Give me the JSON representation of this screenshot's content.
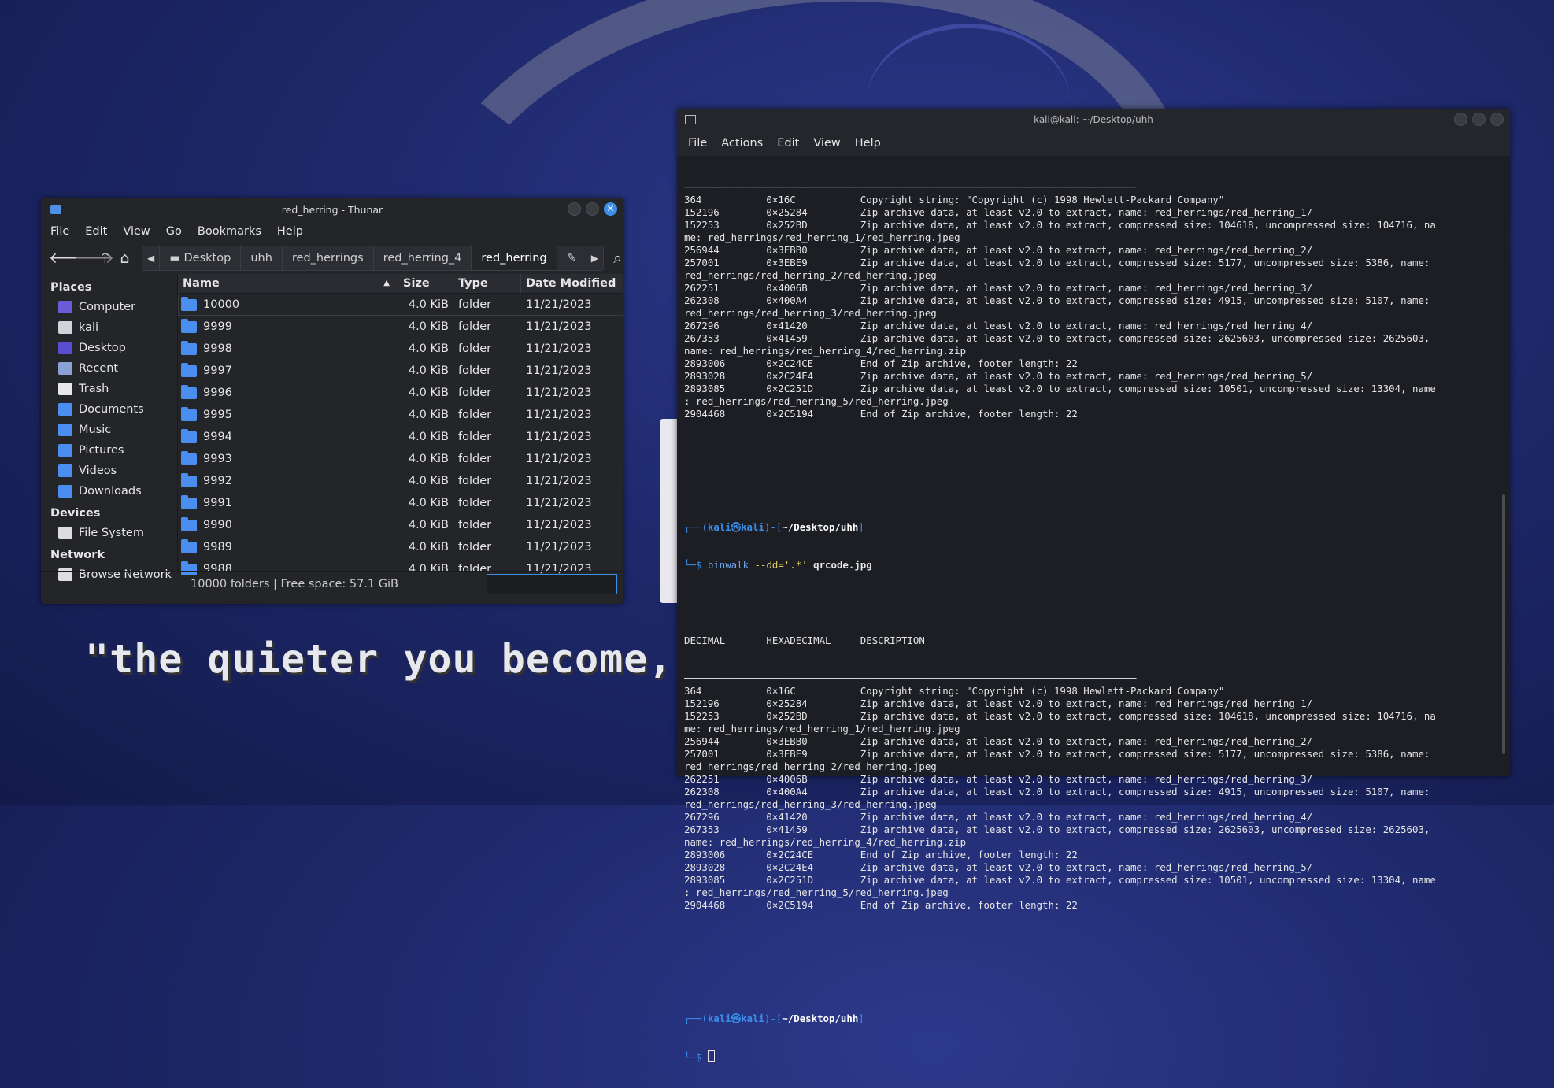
{
  "quote": "\"the quieter you become, th",
  "thunar": {
    "title": "red_herring - Thunar",
    "menu": [
      "File",
      "Edit",
      "View",
      "Go",
      "Bookmarks",
      "Help"
    ],
    "breadcrumbs": [
      "Desktop",
      "uhh",
      "red_herrings",
      "red_herring_4",
      "red_herring"
    ],
    "sidebar": {
      "places_label": "Places",
      "places": [
        {
          "label": "Computer",
          "icon": "computer-icon",
          "color": "#6a5bd6"
        },
        {
          "label": "kali",
          "icon": "home-folder-icon",
          "color": "#cfd3da"
        },
        {
          "label": "Desktop",
          "icon": "desktop-icon",
          "color": "#5a4ed0"
        },
        {
          "label": "Recent",
          "icon": "recent-icon",
          "color": "#8aa0d6"
        },
        {
          "label": "Trash",
          "icon": "trash-icon",
          "color": "#e8e8e8"
        },
        {
          "label": "Documents",
          "icon": "documents-icon",
          "color": "#4a8ff0"
        },
        {
          "label": "Music",
          "icon": "music-icon",
          "color": "#4a8ff0"
        },
        {
          "label": "Pictures",
          "icon": "pictures-icon",
          "color": "#4a8ff0"
        },
        {
          "label": "Videos",
          "icon": "videos-icon",
          "color": "#4a8ff0"
        },
        {
          "label": "Downloads",
          "icon": "downloads-icon",
          "color": "#4a8ff0"
        }
      ],
      "devices_label": "Devices",
      "devices": [
        {
          "label": "File System",
          "icon": "drive-icon",
          "color": "#dddddd"
        }
      ],
      "network_label": "Network",
      "network": [
        {
          "label": "Browse Network",
          "icon": "network-icon",
          "color": "#dddddd"
        }
      ]
    },
    "columns": [
      "Name",
      "Size",
      "Type",
      "Date Modified"
    ],
    "rows": [
      {
        "name": "10000",
        "size": "4.0 KiB",
        "type": "folder",
        "date": "11/21/2023"
      },
      {
        "name": "9999",
        "size": "4.0 KiB",
        "type": "folder",
        "date": "11/21/2023"
      },
      {
        "name": "9998",
        "size": "4.0 KiB",
        "type": "folder",
        "date": "11/21/2023"
      },
      {
        "name": "9997",
        "size": "4.0 KiB",
        "type": "folder",
        "date": "11/21/2023"
      },
      {
        "name": "9996",
        "size": "4.0 KiB",
        "type": "folder",
        "date": "11/21/2023"
      },
      {
        "name": "9995",
        "size": "4.0 KiB",
        "type": "folder",
        "date": "11/21/2023"
      },
      {
        "name": "9994",
        "size": "4.0 KiB",
        "type": "folder",
        "date": "11/21/2023"
      },
      {
        "name": "9993",
        "size": "4.0 KiB",
        "type": "folder",
        "date": "11/21/2023"
      },
      {
        "name": "9992",
        "size": "4.0 KiB",
        "type": "folder",
        "date": "11/21/2023"
      },
      {
        "name": "9991",
        "size": "4.0 KiB",
        "type": "folder",
        "date": "11/21/2023"
      },
      {
        "name": "9990",
        "size": "4.0 KiB",
        "type": "folder",
        "date": "11/21/2023"
      },
      {
        "name": "9989",
        "size": "4.0 KiB",
        "type": "folder",
        "date": "11/21/2023"
      },
      {
        "name": "9988",
        "size": "4.0 KiB",
        "type": "folder",
        "date": "11/21/2023"
      }
    ],
    "status": "10000 folders  |  Free space: 57.1 GiB"
  },
  "terminal": {
    "title": "kali@kali: ~/Desktop/uhh",
    "menu": [
      "File",
      "Actions",
      "Edit",
      "View",
      "Help"
    ],
    "output1": [
      "─────────────────────────────────────────────────────────────────────────────",
      "364           0×16C           Copyright string: \"Copyright (c) 1998 Hewlett-Packard Company\"",
      "152196        0×25284         Zip archive data, at least v2.0 to extract, name: red_herrings/red_herring_1/",
      "152253        0×252BD         Zip archive data, at least v2.0 to extract, compressed size: 104618, uncompressed size: 104716, na",
      "me: red_herrings/red_herring_1/red_herring.jpeg",
      "256944        0×3EBB0         Zip archive data, at least v2.0 to extract, name: red_herrings/red_herring_2/",
      "257001        0×3EBE9         Zip archive data, at least v2.0 to extract, compressed size: 5177, uncompressed size: 5386, name:",
      "red_herrings/red_herring_2/red_herring.jpeg",
      "262251        0×4006B         Zip archive data, at least v2.0 to extract, name: red_herrings/red_herring_3/",
      "262308        0×400A4         Zip archive data, at least v2.0 to extract, compressed size: 4915, uncompressed size: 5107, name:",
      "red_herrings/red_herring_3/red_herring.jpeg",
      "267296        0×41420         Zip archive data, at least v2.0 to extract, name: red_herrings/red_herring_4/",
      "267353        0×41459         Zip archive data, at least v2.0 to extract, compressed size: 2625603, uncompressed size: 2625603,",
      "name: red_herrings/red_herring_4/red_herring.zip",
      "2893006       0×2C24CE        End of Zip archive, footer length: 22",
      "2893028       0×2C24E4        Zip archive data, at least v2.0 to extract, name: red_herrings/red_herring_5/",
      "2893085       0×2C251D        Zip archive data, at least v2.0 to extract, compressed size: 10501, uncompressed size: 13304, name",
      ": red_herrings/red_herring_5/red_herring.jpeg",
      "2904468       0×2C5194        End of Zip archive, footer length: 22"
    ],
    "prompt_user": "kali",
    "prompt_at": "㉿",
    "prompt_host": "kali",
    "prompt_path": "~/Desktop/uhh",
    "command": "binwalk",
    "command_args": " --dd='.*' ",
    "command_file": "qrcode.jpg",
    "header": "DECIMAL       HEXADECIMAL     DESCRIPTION",
    "output2": [
      "─────────────────────────────────────────────────────────────────────────────",
      "364           0×16C           Copyright string: \"Copyright (c) 1998 Hewlett-Packard Company\"",
      "152196        0×25284         Zip archive data, at least v2.0 to extract, name: red_herrings/red_herring_1/",
      "152253        0×252BD         Zip archive data, at least v2.0 to extract, compressed size: 104618, uncompressed size: 104716, na",
      "me: red_herrings/red_herring_1/red_herring.jpeg",
      "256944        0×3EBB0         Zip archive data, at least v2.0 to extract, name: red_herrings/red_herring_2/",
      "257001        0×3EBE9         Zip archive data, at least v2.0 to extract, compressed size: 5177, uncompressed size: 5386, name:",
      "red_herrings/red_herring_2/red_herring.jpeg",
      "262251        0×4006B         Zip archive data, at least v2.0 to extract, name: red_herrings/red_herring_3/",
      "262308        0×400A4         Zip archive data, at least v2.0 to extract, compressed size: 4915, uncompressed size: 5107, name:",
      "red_herrings/red_herring_3/red_herring.jpeg",
      "267296        0×41420         Zip archive data, at least v2.0 to extract, name: red_herrings/red_herring_4/",
      "267353        0×41459         Zip archive data, at least v2.0 to extract, compressed size: 2625603, uncompressed size: 2625603,",
      "name: red_herrings/red_herring_4/red_herring.zip",
      "2893006       0×2C24CE        End of Zip archive, footer length: 22",
      "2893028       0×2C24E4        Zip archive data, at least v2.0 to extract, name: red_herrings/red_herring_5/",
      "2893085       0×2C251D        Zip archive data, at least v2.0 to extract, compressed size: 10501, uncompressed size: 13304, name",
      ": red_herrings/red_herring_5/red_herring.jpeg",
      "2904468       0×2C5194        End of Zip archive, footer length: 22"
    ]
  }
}
